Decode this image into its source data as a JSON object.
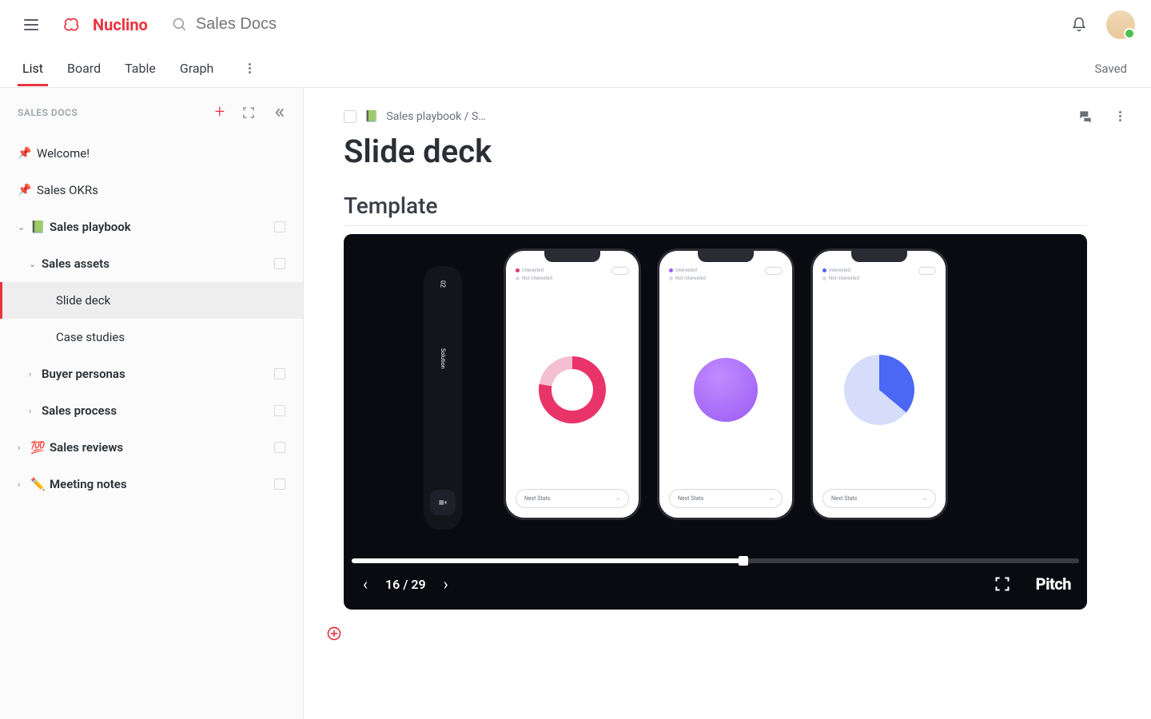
{
  "app": {
    "name": "Nuclino"
  },
  "search": {
    "placeholder": "Sales Docs"
  },
  "saved_label": "Saved",
  "tabs": {
    "list": "List",
    "board": "Board",
    "table": "Table",
    "graph": "Graph"
  },
  "sidebar": {
    "title": "SALES DOCS",
    "welcome": "Welcome!",
    "okrs": "Sales OKRs",
    "playbook": "Sales playbook",
    "playbook_icon": "📗",
    "assets": "Sales assets",
    "slide_deck": "Slide deck",
    "case_studies": "Case studies",
    "personas": "Buyer personas",
    "process": "Sales process",
    "reviews": "Sales reviews",
    "reviews_icon": "💯",
    "notes": "Meeting notes",
    "notes_icon": "✏️"
  },
  "breadcrumb": {
    "icon": "📗",
    "text": "Sales playbook / S…"
  },
  "page": {
    "title": "Slide deck",
    "section": "Template"
  },
  "slide": {
    "side_num": "02",
    "side_label": "Solution",
    "legend_a": "Interested",
    "legend_b": "Not interested",
    "next_btn": "Next Stats",
    "counter": "16 / 29",
    "brand": "Pitch"
  },
  "colors": {
    "accent": "#e9343f"
  }
}
